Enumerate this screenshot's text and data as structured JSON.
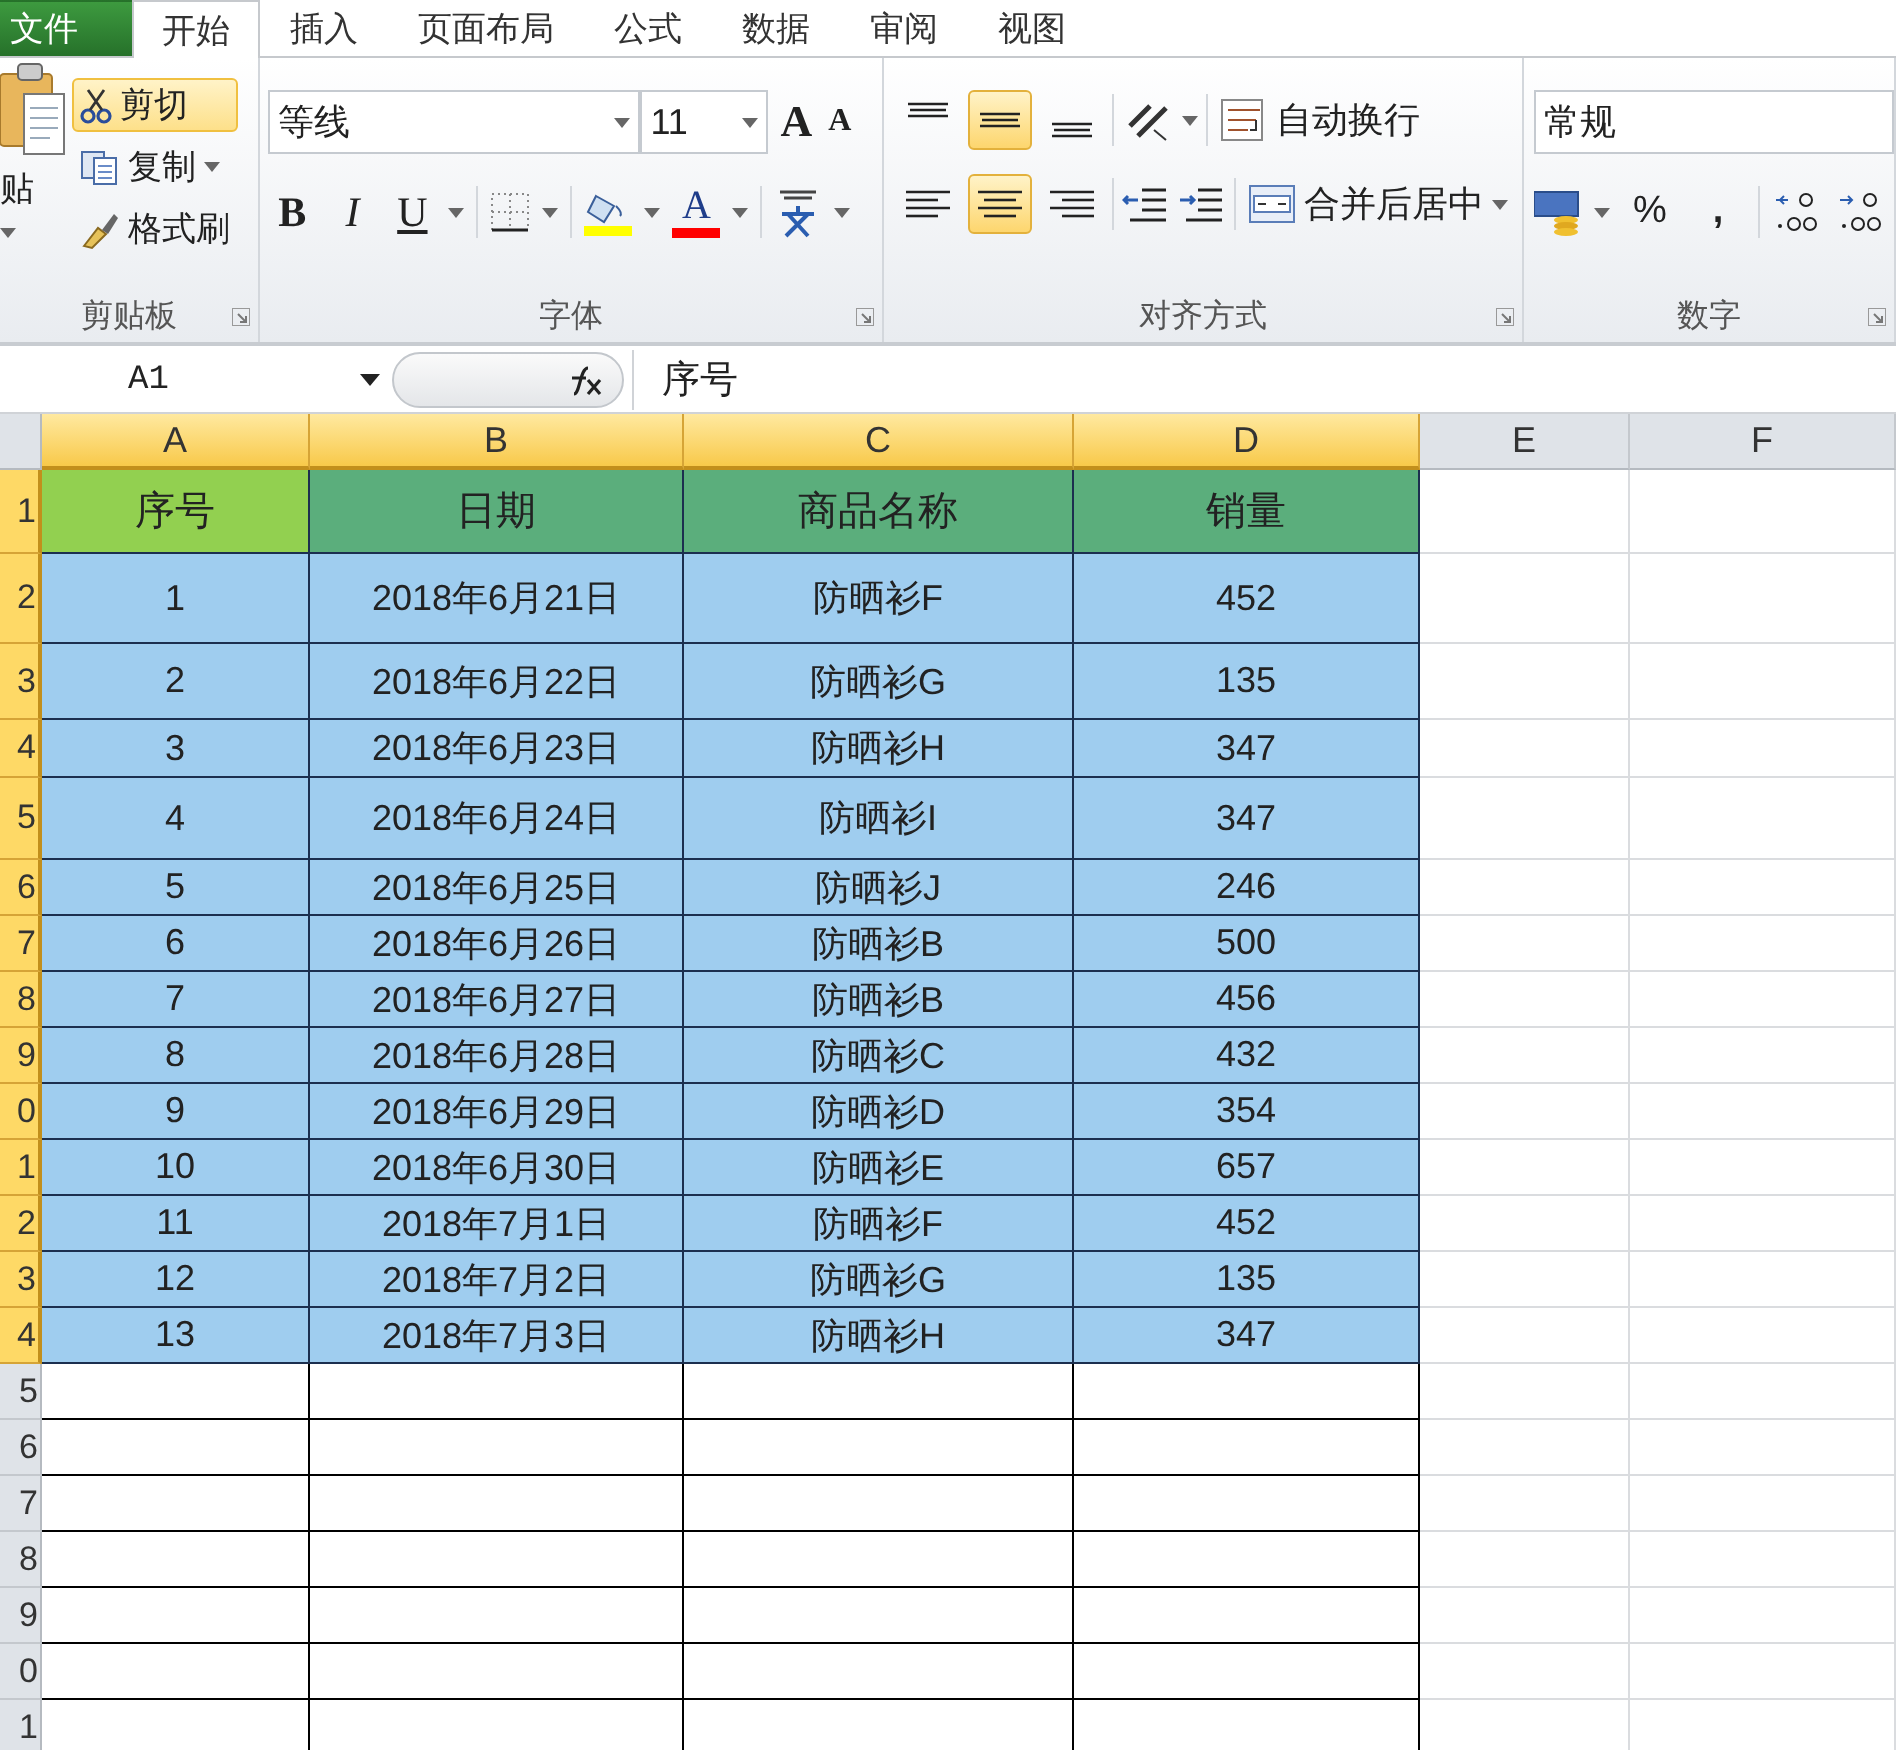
{
  "tabs": [
    {
      "label": "文件",
      "kind": "file",
      "selected": false
    },
    {
      "label": "开始",
      "kind": "tab",
      "selected": true
    },
    {
      "label": "插入",
      "kind": "tab",
      "selected": false
    },
    {
      "label": "页面布局",
      "kind": "tab",
      "selected": false
    },
    {
      "label": "公式",
      "kind": "tab",
      "selected": false
    },
    {
      "label": "数据",
      "kind": "tab",
      "selected": false
    },
    {
      "label": "审阅",
      "kind": "tab",
      "selected": false
    },
    {
      "label": "视图",
      "kind": "tab",
      "selected": false
    }
  ],
  "clipboard": {
    "paste": "贴",
    "cut": {
      "label": "剪切",
      "selected": true
    },
    "copy": "复制",
    "painter": "格式刷",
    "title": "剪贴板"
  },
  "font": {
    "name": "等线",
    "size": "11",
    "grow": "A",
    "shrink": "A",
    "bold": "B",
    "italic": "I",
    "underline": "U",
    "font_color": "A",
    "title": "字体"
  },
  "alignment": {
    "vertical": [
      {
        "kind": "top",
        "selected": false
      },
      {
        "kind": "middle",
        "selected": true
      },
      {
        "kind": "bottom",
        "selected": false
      }
    ],
    "horizontal": [
      {
        "kind": "left",
        "selected": false
      },
      {
        "kind": "center",
        "selected": true
      },
      {
        "kind": "right",
        "selected": false
      }
    ],
    "wrap": "自动换行",
    "merge": "合并后居中",
    "title": "对齐方式"
  },
  "number": {
    "format": "常规",
    "percent": "%",
    "comma": ",",
    "title": "数字"
  },
  "formula_bar": {
    "name_box": "A1",
    "content": "序号"
  },
  "sheet": {
    "columns": [
      {
        "label": "A",
        "selected": true
      },
      {
        "label": "B",
        "selected": true
      },
      {
        "label": "C",
        "selected": true
      },
      {
        "label": "D",
        "selected": true
      },
      {
        "label": "E",
        "selected": false
      },
      {
        "label": "F",
        "selected": false
      }
    ],
    "rows": [
      {
        "number": "1",
        "selected": true,
        "kind": "header",
        "active": true,
        "cells": [
          "序号",
          "日期",
          "商品名称",
          "销量"
        ]
      },
      {
        "number": "2",
        "selected": true,
        "kind": "data",
        "cells": [
          "1",
          "2018年6月21日",
          "防晒衫F",
          "452"
        ]
      },
      {
        "number": "3",
        "selected": true,
        "kind": "data",
        "cells": [
          "2",
          "2018年6月22日",
          "防晒衫G",
          "135"
        ]
      },
      {
        "number": "4",
        "selected": true,
        "kind": "data",
        "cells": [
          "3",
          "2018年6月23日",
          "防晒衫H",
          "347"
        ]
      },
      {
        "number": "5",
        "selected": true,
        "kind": "data",
        "cells": [
          "4",
          "2018年6月24日",
          "防晒衫I",
          "347"
        ]
      },
      {
        "number": "6",
        "selected": true,
        "kind": "data",
        "cells": [
          "5",
          "2018年6月25日",
          "防晒衫J",
          "246"
        ]
      },
      {
        "number": "7",
        "selected": true,
        "kind": "data",
        "cells": [
          "6",
          "2018年6月26日",
          "防晒衫B",
          "500"
        ]
      },
      {
        "number": "8",
        "selected": true,
        "kind": "data",
        "cells": [
          "7",
          "2018年6月27日",
          "防晒衫B",
          "456"
        ]
      },
      {
        "number": "9",
        "selected": true,
        "kind": "data",
        "cells": [
          "8",
          "2018年6月28日",
          "防晒衫C",
          "432"
        ]
      },
      {
        "number": "0",
        "selected": true,
        "kind": "data",
        "cells": [
          "9",
          "2018年6月29日",
          "防晒衫D",
          "354"
        ]
      },
      {
        "number": "1",
        "selected": true,
        "kind": "data",
        "cells": [
          "10",
          "2018年6月30日",
          "防晒衫E",
          "657"
        ]
      },
      {
        "number": "2",
        "selected": true,
        "kind": "data",
        "cells": [
          "11",
          "2018年7月1日",
          "防晒衫F",
          "452"
        ]
      },
      {
        "number": "3",
        "selected": true,
        "kind": "data",
        "cells": [
          "12",
          "2018年7月2日",
          "防晒衫G",
          "135"
        ]
      },
      {
        "number": "4",
        "selected": true,
        "kind": "data",
        "cells": [
          "13",
          "2018年7月3日",
          "防晒衫H",
          "347"
        ]
      },
      {
        "number": "5",
        "selected": false,
        "kind": "empty"
      },
      {
        "number": "6",
        "selected": false,
        "kind": "empty"
      },
      {
        "number": "7",
        "selected": false,
        "kind": "empty"
      },
      {
        "number": "8",
        "selected": false,
        "kind": "empty"
      },
      {
        "number": "9",
        "selected": false,
        "kind": "empty"
      },
      {
        "number": "0",
        "selected": false,
        "kind": "empty"
      },
      {
        "number": "1",
        "selected": false,
        "kind": "empty"
      }
    ]
  }
}
